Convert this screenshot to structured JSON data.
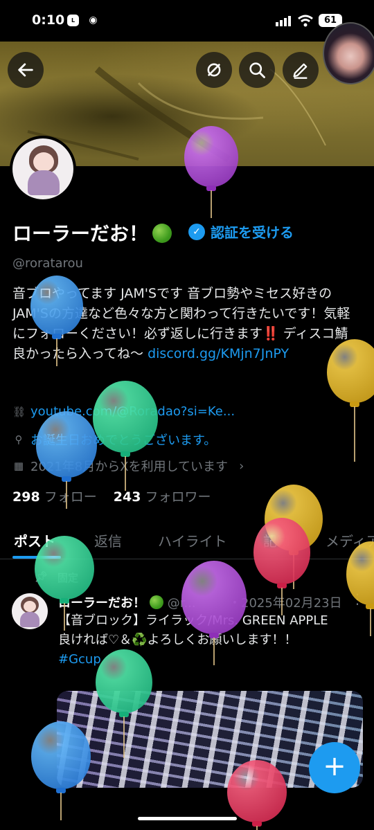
{
  "status_bar": {
    "time": "0:10",
    "battery": "61",
    "app_icons": [
      "line-icon",
      "discord-icon"
    ]
  },
  "toolbar": {
    "back_icon": "back-arrow-icon",
    "hide_icon": "eye-off-icon",
    "search_icon": "search-icon",
    "edit_icon": "pencil-icon"
  },
  "profile": {
    "display_name": "ローラーだお！",
    "verify_label": "認証を受ける",
    "handle": "@roratarou",
    "bio_parts": {
      "p1": "音ブロやってます JAM'Sです 音ブロ勢やミセス好きのJAM'Sの方達など色々な方と関わって行きたいです！気軽にフォローください！必ず返しに行きます",
      "bang": "‼️",
      "p2": " ディスコ鯖良かったら入ってね〜 ",
      "link": "discord.gg/KMjn7JnPY"
    },
    "website": "youtube.com/@Roradao?si=Ke...",
    "birthday": "お誕生日おめでとうございます。",
    "joined": "2021年8月からXを利用しています",
    "following_count": "298",
    "following_label": "フォロー",
    "followers_count": "243",
    "followers_label": "フォロワー"
  },
  "tabs": [
    "ポスト",
    "返信",
    "ハイライト",
    "記事",
    "メディア"
  ],
  "pinned_label": "固定",
  "post": {
    "author": "ローラーだお！",
    "handle_trunc": "@r...",
    "date": "・2025年02月23日",
    "line1": "【音ブロック】ライラック/Mrs. GREEN APPLE",
    "line2": "良ければ♡＆♻️よろしくお願いします！！",
    "hashtag": "#Gcup"
  },
  "colors": {
    "accent": "#1d9bf0",
    "background": "#000000",
    "secondary_text": "#71767b"
  },
  "decorations": [
    "purple-balloon",
    "blue-balloon",
    "green-balloon",
    "yellow-balloon",
    "red-balloon"
  ]
}
